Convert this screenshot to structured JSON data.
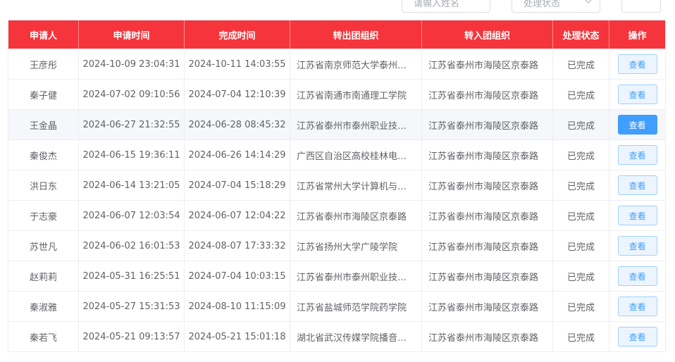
{
  "filters": {
    "name_placeholder": "请输入姓名",
    "status_placeholder": "处理状态"
  },
  "table": {
    "headers": [
      "申请人",
      "申请时间",
      "完成时间",
      "转出团组织",
      "转入团组织",
      "处理状态",
      "操作"
    ],
    "rows": [
      {
        "applicant": "王彦彤",
        "apply_time": "2024-10-09 23:04:31",
        "done_time": "2024-10-11 14:03:55",
        "from_org": "江苏省南京师范大学泰州学院",
        "to_org": "江苏省泰州市海陵区京泰路",
        "status": "已完成",
        "action": "查看"
      },
      {
        "applicant": "秦子健",
        "apply_time": "2024-07-02 09:10:56",
        "done_time": "2024-07-04 12:10:39",
        "from_org": "江苏省南通市南通理工学院",
        "to_org": "江苏省泰州市海陵区京泰路",
        "status": "已完成",
        "action": "查看"
      },
      {
        "applicant": "王金晶",
        "apply_time": "2024-06-27 21:32:55",
        "done_time": "2024-06-28 08:45:32",
        "from_org": "江苏省泰州市泰州职业技术学院",
        "to_org": "江苏省泰州市海陵区京泰路",
        "status": "已完成",
        "action": "查看"
      },
      {
        "applicant": "秦俊杰",
        "apply_time": "2024-06-15 19:36:11",
        "done_time": "2024-06-26 14:14:29",
        "from_org": "广西区自治区高校桂林电子科技大学",
        "to_org": "江苏省泰州市海陵区京泰路",
        "status": "已完成",
        "action": "查看"
      },
      {
        "applicant": "洪日东",
        "apply_time": "2024-06-14 13:21:05",
        "done_time": "2024-07-04 15:18:29",
        "from_org": "江苏省常州大学计算机与人工智能学院",
        "to_org": "江苏省泰州市海陵区京泰路",
        "status": "已完成",
        "action": "查看"
      },
      {
        "applicant": "于志豪",
        "apply_time": "2024-06-07 12:03:54",
        "done_time": "2024-06-07 12:04:22",
        "from_org": "江苏省泰州市海陵区京泰路",
        "to_org": "江苏省泰州市海陵区京泰路",
        "status": "已完成",
        "action": "查看"
      },
      {
        "applicant": "苏世凡",
        "apply_time": "2024-06-02 16:01:53",
        "done_time": "2024-08-07 17:33:32",
        "from_org": "江苏省扬州大学广陵学院",
        "to_org": "江苏省泰州市海陵区京泰路",
        "status": "已完成",
        "action": "查看"
      },
      {
        "applicant": "赵莉莉",
        "apply_time": "2024-05-31 16:25:51",
        "done_time": "2024-07-04 10:03:15",
        "from_org": "江苏省泰州市泰州职业技术学院",
        "to_org": "江苏省泰州市海陵区京泰路",
        "status": "已完成",
        "action": "查看"
      },
      {
        "applicant": "秦淑雅",
        "apply_time": "2024-05-27 15:31:53",
        "done_time": "2024-08-10 11:15:09",
        "from_org": "江苏省盐城师范学院药学院",
        "to_org": "江苏省泰州市海陵区京泰路",
        "status": "已完成",
        "action": "查看"
      },
      {
        "applicant": "秦若飞",
        "apply_time": "2024-05-21 09:13:57",
        "done_time": "2024-05-21 15:01:18",
        "from_org": "湖北省武汉传媒学院播音主持学院",
        "to_org": "江苏省泰州市海陵区京泰路",
        "status": "已完成",
        "action": "查看"
      }
    ]
  },
  "colors": {
    "header_bg": "#f5353b",
    "button_primary": "#409eff"
  }
}
